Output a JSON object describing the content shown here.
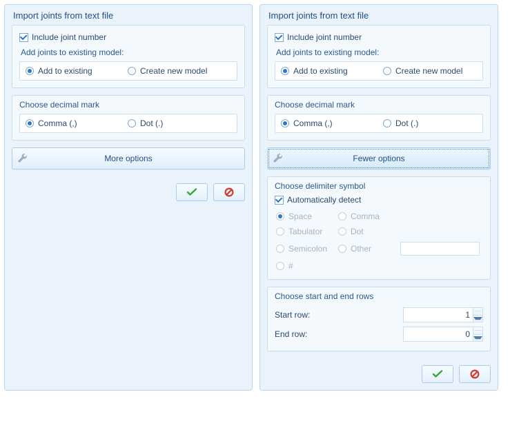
{
  "left": {
    "title": "Import joints from text file",
    "include_joint_number_label": "Include joint number",
    "include_joint_number_checked": true,
    "add_joints_label": "Add joints to existing model:",
    "radio_add": "Add to existing",
    "radio_create": "Create new model",
    "add_selected": "add",
    "decimal_legend": "Choose decimal mark",
    "radio_comma": "Comma (,)",
    "radio_dot": "Dot (.)",
    "decimal_selected": "comma",
    "options_label": "More options"
  },
  "right": {
    "title": "Import joints from text file",
    "include_joint_number_label": "Include joint number",
    "include_joint_number_checked": true,
    "add_joints_label": "Add joints to existing model:",
    "radio_add": "Add to existing",
    "radio_create": "Create new model",
    "add_selected": "add",
    "decimal_legend": "Choose decimal mark",
    "radio_comma": "Comma (,)",
    "radio_dot": "Dot (.)",
    "decimal_selected": "comma",
    "options_label": "Fewer options",
    "delimiter_legend": "Choose delimiter symbol",
    "auto_detect_label": "Automatically detect",
    "auto_detect_checked": true,
    "delims": {
      "space": "Space",
      "tabulator": "Tabulator",
      "semicolon": "Semicolon",
      "hash": "#",
      "comma": "Comma",
      "dot": "Dot",
      "other": "Other",
      "selected": "space"
    },
    "rows_legend": "Choose start and end rows",
    "start_row_label": "Start row:",
    "end_row_label": "End row:",
    "start_row_value": "1",
    "end_row_value": "0"
  },
  "icons": {
    "wrench": "wrench-icon",
    "ok": "ok-icon",
    "cancel": "cancel-icon"
  }
}
